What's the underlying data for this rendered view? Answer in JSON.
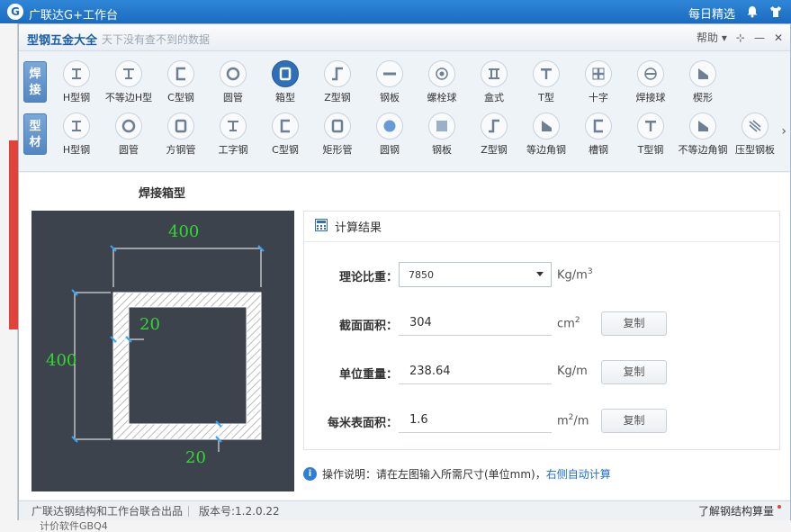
{
  "host": {
    "logo": "G",
    "title": "广联达G+工作台",
    "daily_pick": "每日精选",
    "bottom_text": "计价软件GBQ4"
  },
  "window": {
    "title": "型钢五金大全",
    "slogan": "天下没有查不到的数据",
    "help": "帮助",
    "pin": "⊹",
    "minimize": "—",
    "close": "✕"
  },
  "toolbar": {
    "weld_category": [
      "焊",
      "接"
    ],
    "section_category": [
      "型",
      "材"
    ],
    "weld_items": [
      "H型钢",
      "不等边H型",
      "C型钢",
      "圆管",
      "箱型",
      "Z型钢",
      "钢板",
      "螺栓球",
      "盒式",
      "T型",
      "十字",
      "焊接球",
      "楔形"
    ],
    "section_items": [
      "H型钢",
      "圆管",
      "方钢管",
      "工字钢",
      "C型钢",
      "矩形管",
      "圆钢",
      "钢板",
      "Z型钢",
      "等边角钢",
      "槽钢",
      "T型钢",
      "不等边角钢",
      "压型钢板"
    ],
    "active_index": 4
  },
  "diagram": {
    "title": "焊接箱型",
    "width": "400",
    "height": "400",
    "web_thickness": "20",
    "flange_thickness": "20"
  },
  "results": {
    "header": "计算结果",
    "density_label": "理论比重：",
    "density_value": "7850",
    "density_unit": "Kg/m",
    "density_unit_sup": "3",
    "area_label": "截面面积：",
    "area_value": "304",
    "area_unit": "cm",
    "area_unit_sup": "2",
    "weight_label": "单位重量：",
    "weight_value": "238.64",
    "weight_unit": "Kg/m",
    "surface_label": "每米表面积：",
    "surface_value": "1.6",
    "surface_unit": "m",
    "surface_unit_sup": "2",
    "surface_unit_tail": "/m",
    "copy_label": "复制"
  },
  "note": {
    "info": "i",
    "text": "操作说明：请在左图输入所需尺寸(单位mm)，",
    "link": "右侧自动计算"
  },
  "status": {
    "producer": "广联达钢结构和工作台联合出品",
    "version": "版本号:1.2.0.22",
    "learn": "了解钢结构算量"
  },
  "colors": {
    "accent": "#1b5ea8",
    "dimension": "#33d633",
    "diagram_bg": "#3c434c",
    "active_tool": "#2f6fba"
  }
}
